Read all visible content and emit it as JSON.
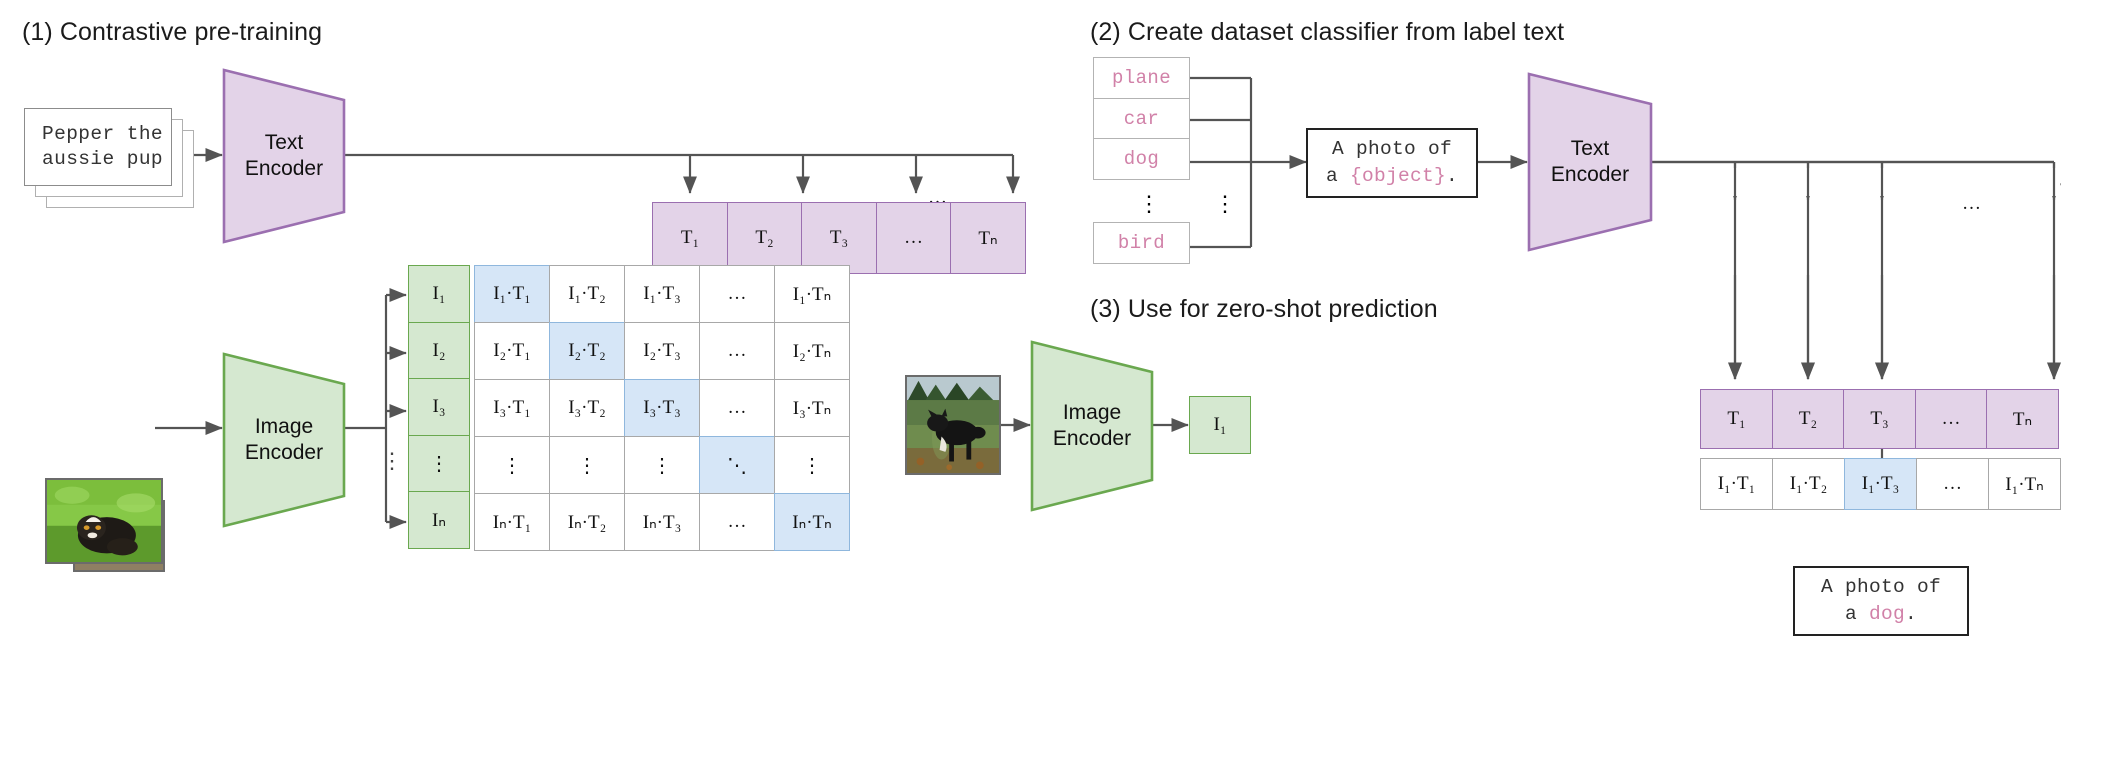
{
  "sections": {
    "one": {
      "heading": "(1) Contrastive pre-training"
    },
    "two": {
      "heading": "(2) Create dataset classifier from label text"
    },
    "three": {
      "heading": "(3) Use for zero-shot prediction"
    }
  },
  "encoders": {
    "text_line1": "Text",
    "text_line2": "Encoder",
    "image_line1": "Image",
    "image_line2": "Encoder"
  },
  "caption": {
    "line1": "Pepper the",
    "line2": "aussie pup"
  },
  "section1": {
    "text_embeddings": [
      "T₁",
      "T₂",
      "T₃",
      "…",
      "Tₙ"
    ],
    "image_embeddings": [
      "I₁",
      "I₂",
      "I₃",
      "⋮",
      "Iₙ"
    ],
    "matrix_rows": [
      [
        "I₁·T₁",
        "I₁·T₂",
        "I₁·T₃",
        "…",
        "I₁·Tₙ"
      ],
      [
        "I₂·T₁",
        "I₂·T₂",
        "I₂·T₃",
        "…",
        "I₂·Tₙ"
      ],
      [
        "I₃·T₁",
        "I₃·T₂",
        "I₃·T₃",
        "…",
        "I₃·Tₙ"
      ],
      [
        "⋮",
        "⋮",
        "⋮",
        "⋱",
        "⋮"
      ],
      [
        "Iₙ·T₁",
        "Iₙ·T₂",
        "Iₙ·T₃",
        "…",
        "Iₙ·Tₙ"
      ]
    ],
    "highlighted": [
      [
        0,
        0
      ],
      [
        1,
        1
      ],
      [
        2,
        2
      ],
      [
        3,
        3
      ],
      [
        4,
        4
      ]
    ],
    "ellipsis_top": "…"
  },
  "section2": {
    "labels": [
      "plane",
      "car",
      "dog",
      "bird"
    ],
    "label_vdots_left": "⋮",
    "label_vdots_right": "⋮",
    "prompt_line1": "A photo of",
    "prompt_line2_prefix": "a ",
    "prompt_line2_slot": "{object}",
    "prompt_line2_suffix": "."
  },
  "section3": {
    "image_embedding": "I₁",
    "text_embeddings": [
      "T₁",
      "T₂",
      "T₃",
      "…",
      "Tₙ"
    ],
    "score_row": [
      "I₁·T₁",
      "I₁·T₂",
      "I₁·T₃",
      "…",
      "I₁·Tₙ"
    ],
    "highlighted_index": 2,
    "ellipsis_top": "…",
    "prediction_line1": "A photo of",
    "prediction_line2_prefix": "a ",
    "prediction_line2_word": "dog",
    "prediction_line2_suffix": "."
  },
  "colors": {
    "text_encoder_fill": "#e3d3e8",
    "text_encoder_stroke": "#9b6fb0",
    "image_encoder_fill": "#d5e8d0",
    "image_encoder_stroke": "#6aa84f",
    "highlight_cell": "#d6e6f7",
    "highlight_stroke": "#8fb7dd",
    "label_text": "#d181a8",
    "wire": "#545454"
  }
}
